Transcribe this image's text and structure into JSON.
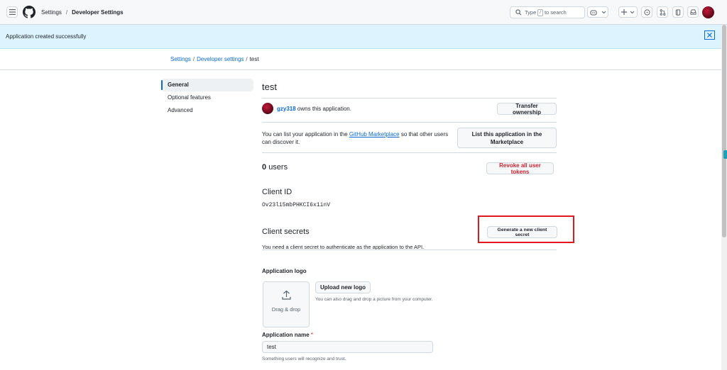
{
  "header": {
    "crumbs": [
      "Settings",
      "Developer Settings"
    ],
    "search_prefix": "Type",
    "search_key": "/",
    "search_suffix": "to search"
  },
  "flash": {
    "message": "Application created successfully"
  },
  "breadcrumb": {
    "items": [
      "Settings",
      "Developer settings",
      "test"
    ]
  },
  "sidebar": {
    "items": [
      {
        "label": "General",
        "active": true
      },
      {
        "label": "Optional features",
        "active": false
      },
      {
        "label": "Advanced",
        "active": false
      }
    ]
  },
  "app": {
    "title": "test",
    "owner": "gzy318",
    "owner_suffix": "owns this application.",
    "transfer_label": "Transfer ownership",
    "marketplace_text_1": "You can list your application in the",
    "marketplace_link": "GitHub Marketplace",
    "marketplace_text_2": "so that other users can discover it.",
    "marketplace_button": "List this application in the Marketplace",
    "users_count": "0",
    "users_label": "users",
    "revoke_label": "Revoke all user tokens",
    "client_id_heading": "Client ID",
    "client_id": "Ov23li5mbPHKCI6x1inV",
    "client_secrets_heading": "Client secrets",
    "generate_secret_label": "Generate a new client secret",
    "secret_note": "You need a client secret to authenticate as the application to the API.",
    "logo_heading": "Application logo",
    "dropzone_label": "Drag & drop",
    "upload_logo_label": "Upload new logo",
    "logo_hint": "You can also drag and drop a picture from your computer.",
    "name_label": "Application name",
    "name_required": "*",
    "name_value": "test",
    "name_hint": "Something users will recognize and trust."
  },
  "colors": {
    "accent": "#0969da",
    "danger": "#cf222e",
    "flash_bg": "#ddf4ff",
    "highlight": "#e0191e"
  }
}
